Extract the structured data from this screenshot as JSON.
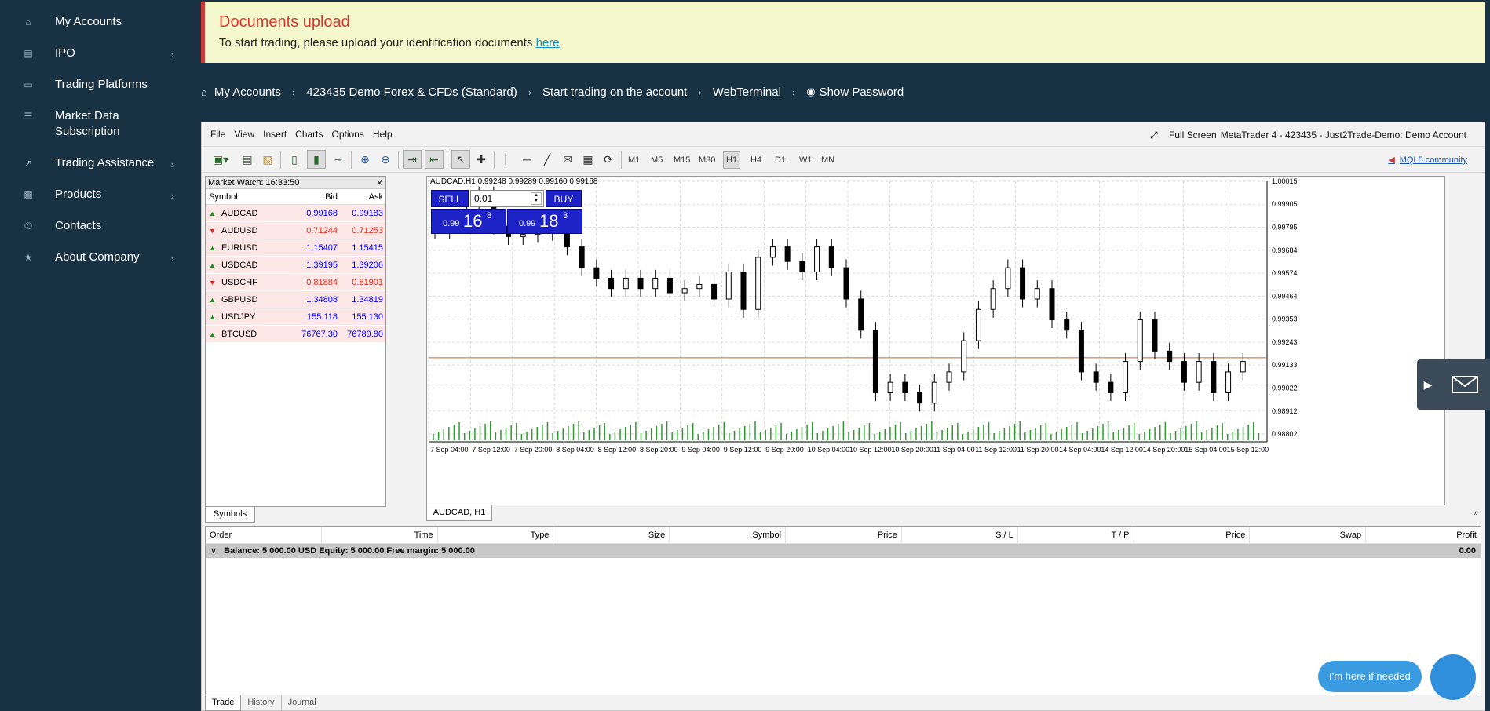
{
  "sidebar": {
    "items": [
      {
        "label": "My Accounts",
        "icon": "home-icon",
        "chevron": false
      },
      {
        "label": "IPO",
        "icon": "bar-chart-icon",
        "chevron": true
      },
      {
        "label": "Trading Platforms",
        "icon": "monitor-icon",
        "chevron": false
      },
      {
        "label": "Market Data Subscription",
        "icon": "list-icon",
        "chevron": false
      },
      {
        "label": "Trading Assistance",
        "icon": "line-chart-icon",
        "chevron": true
      },
      {
        "label": "Products",
        "icon": "briefcase-icon",
        "chevron": true
      },
      {
        "label": "Contacts",
        "icon": "phone-icon",
        "chevron": false
      },
      {
        "label": "About Company",
        "icon": "bank-icon",
        "chevron": true
      }
    ]
  },
  "alert": {
    "title": "Documents upload",
    "text": "To start trading, please upload your identification documents",
    "link": "here",
    "end": "."
  },
  "breadcrumb": {
    "items": [
      "My Accounts",
      "423435 Demo Forex & CFDs (Standard)",
      "Start trading on the account",
      "WebTerminal",
      "Show Password"
    ]
  },
  "terminal": {
    "menu": [
      "File",
      "View",
      "Insert",
      "Charts",
      "Options",
      "Help"
    ],
    "full_screen": "Full Screen",
    "title": "MetaTrader 4 - 423435 - Just2Trade-Demo: Demo Account",
    "timeframes": [
      "M1",
      "M5",
      "M15",
      "M30",
      "H1",
      "H4",
      "D1",
      "W1",
      "MN"
    ],
    "active_timeframe": "H1",
    "mql": "MQL5.community"
  },
  "market_watch": {
    "title": "Market Watch: 16:33:50",
    "columns": {
      "symbol": "Symbol",
      "bid": "Bid",
      "ask": "Ask"
    },
    "rows": [
      {
        "symbol": "AUDCAD",
        "bid": "0.99168",
        "ask": "0.99183",
        "dir": "up"
      },
      {
        "symbol": "AUDUSD",
        "bid": "0.71244",
        "ask": "0.71253",
        "dir": "down"
      },
      {
        "symbol": "EURUSD",
        "bid": "1.15407",
        "ask": "1.15415",
        "dir": "up"
      },
      {
        "symbol": "USDCAD",
        "bid": "1.39195",
        "ask": "1.39206",
        "dir": "up"
      },
      {
        "symbol": "USDCHF",
        "bid": "0.81884",
        "ask": "0.81901",
        "dir": "down"
      },
      {
        "symbol": "GBPUSD",
        "bid": "1.34808",
        "ask": "1.34819",
        "dir": "up"
      },
      {
        "symbol": "USDJPY",
        "bid": "155.118",
        "ask": "155.130",
        "dir": "up"
      },
      {
        "symbol": "BTCUSD",
        "bid": "76767.30",
        "ask": "76789.80",
        "dir": "up"
      }
    ],
    "tab": "Symbols"
  },
  "chart": {
    "info": "AUDCAD,H1  0.99248 0.99289 0.99160 0.99168",
    "sell": "SELL",
    "buy": "BUY",
    "lot": "0.01",
    "sell_price": {
      "small": "0.99",
      "big": "16",
      "sup": "8"
    },
    "buy_price": {
      "small": "0.99",
      "big": "18",
      "sup": "3"
    },
    "tab": "AUDCAD, H1",
    "more": "»"
  },
  "chart_data": {
    "type": "line",
    "title": "AUDCAD,H1",
    "y_ticks": [
      "1.00015",
      "0.99905",
      "0.99795",
      "0.99684",
      "0.99574",
      "0.99464",
      "0.99353",
      "0.99243",
      "0.99133",
      "0.99022",
      "0.98912",
      "0.98802"
    ],
    "x_ticks": [
      "7 Sep 04:00",
      "7 Sep 12:00",
      "7 Sep 20:00",
      "8 Sep 04:00",
      "8 Sep 12:00",
      "8 Sep 20:00",
      "9 Sep 04:00",
      "9 Sep 12:00",
      "9 Sep 20:00",
      "10 Sep 04:00",
      "10 Sep 12:00",
      "10 Sep 20:00",
      "11 Sep 04:00",
      "11 Sep 12:00",
      "11 Sep 20:00",
      "14 Sep 04:00",
      "14 Sep 12:00",
      "14 Sep 20:00",
      "15 Sep 04:00",
      "15 Sep 12:00"
    ],
    "ylim": [
      0.98802,
      1.00015
    ],
    "current_price": 0.99168,
    "close_series": [
      0.9978,
      0.9981,
      0.999,
      0.9995,
      0.998,
      0.9975,
      0.9976,
      0.9978,
      0.9977,
      0.997,
      0.996,
      0.9955,
      0.995,
      0.9955,
      0.995,
      0.9955,
      0.9948,
      0.995,
      0.9952,
      0.9945,
      0.9958,
      0.994,
      0.9965,
      0.997,
      0.9963,
      0.9958,
      0.997,
      0.996,
      0.9945,
      0.993,
      0.99,
      0.9905,
      0.99,
      0.9895,
      0.9905,
      0.991,
      0.9925,
      0.994,
      0.995,
      0.996,
      0.9945,
      0.995,
      0.9935,
      0.993,
      0.991,
      0.9905,
      0.99,
      0.9915,
      0.9935,
      0.992,
      0.9915,
      0.9905,
      0.9915,
      0.99,
      0.991,
      0.9915
    ]
  },
  "orders": {
    "columns": [
      "Order",
      "Time",
      "Type",
      "Size",
      "Symbol",
      "Price",
      "S / L",
      "T / P",
      "Price",
      "Swap",
      "Profit"
    ],
    "balance": "Balance: 5 000.00 USD  Equity: 5 000.00  Free margin: 5 000.00",
    "profit": "0.00",
    "tabs": [
      "Trade",
      "History",
      "Journal"
    ]
  },
  "chat": {
    "bubble": "I'm here if needed"
  }
}
